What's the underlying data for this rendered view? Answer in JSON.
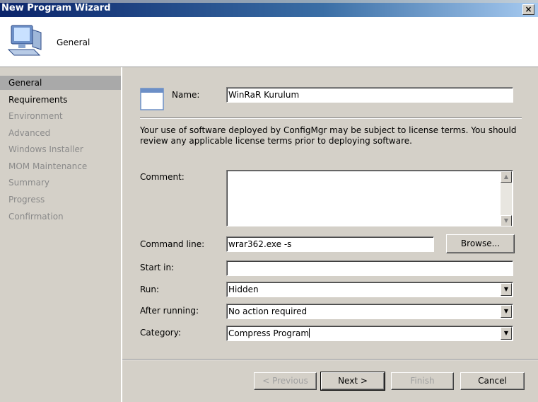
{
  "window": {
    "title": "New Program Wizard",
    "close_glyph": "×"
  },
  "header": {
    "title": "General",
    "icon": "computer-icon"
  },
  "sidebar": {
    "items": [
      {
        "label": "General",
        "state": "selected"
      },
      {
        "label": "Requirements",
        "state": "enabled"
      },
      {
        "label": "Environment",
        "state": "disabled"
      },
      {
        "label": "Advanced",
        "state": "disabled"
      },
      {
        "label": "Windows Installer",
        "state": "disabled"
      },
      {
        "label": "MOM Maintenance",
        "state": "disabled"
      },
      {
        "label": "Summary",
        "state": "disabled"
      },
      {
        "label": "Progress",
        "state": "disabled"
      },
      {
        "label": "Confirmation",
        "state": "disabled"
      }
    ]
  },
  "form": {
    "name_label": "Name:",
    "name_value": "WinRaR Kurulum",
    "license_text": "Your use of software deployed by ConfigMgr may be subject to license terms. You should review any applicable license terms prior to deploying software.",
    "comment_label": "Comment:",
    "comment_value": "",
    "command_label": "Command line:",
    "command_value": "wrar362.exe -s",
    "browse_label": "Browse...",
    "startin_label": "Start in:",
    "startin_value": "",
    "run_label": "Run:",
    "run_value": "Hidden",
    "after_label": "After running:",
    "after_value": "No action required",
    "category_label": "Category:",
    "category_value": "Compress Program"
  },
  "buttons": {
    "previous": "< Previous",
    "next": "Next >",
    "finish": "Finish",
    "cancel": "Cancel"
  },
  "icons": {
    "dropdown_arrow": "▼",
    "scroll_up": "▲",
    "scroll_down": "▼"
  }
}
